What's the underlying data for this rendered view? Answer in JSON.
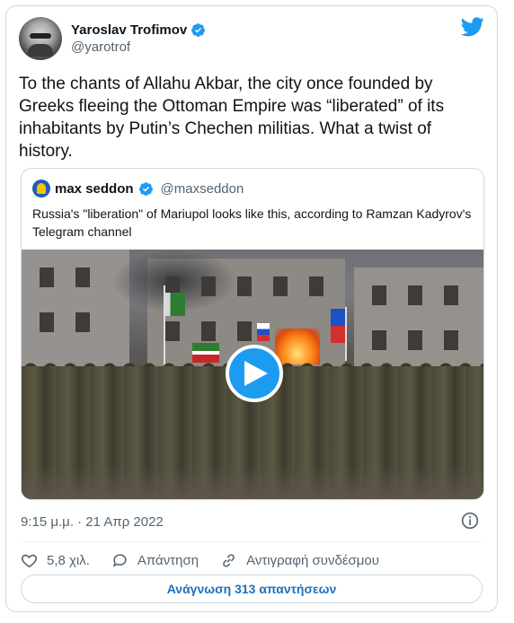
{
  "tweet": {
    "author_name": "Yaroslav Trofimov",
    "author_handle": "@yarotrof",
    "text": "To the chants of Allahu Akbar, the city once founded by Greeks fleeing the Ottoman Empire was “liberated” of its inhabitants by Putin’s Chechen militias. What a twist of history.",
    "timestamp": "9:15 μ.μ. · 21 Απρ 2022",
    "likes": "5,8 χιλ.",
    "reply_label": "Απάντηση",
    "copy_link_label": "Αντιγραφή συνδέσμου",
    "read_replies_label": "Ανάγνωση 313 απαντήσεων"
  },
  "quoted": {
    "author_name": "max seddon",
    "author_handle": "@maxseddon",
    "text": "Russia's \"liberation\" of Mariupol looks like this, according to Ramzan Kadyrov's Telegram channel"
  },
  "icons": {
    "verified": "verified-badge-icon",
    "twitter": "twitter-bird-icon",
    "play": "play-icon",
    "info": "info-icon",
    "like": "heart-icon",
    "reply": "reply-bubble-icon",
    "link": "link-icon"
  },
  "colors": {
    "accent": "#1d9bf0",
    "link_text": "#1d70b8",
    "secondary_text": "#536471",
    "border": "#cfd9de"
  }
}
